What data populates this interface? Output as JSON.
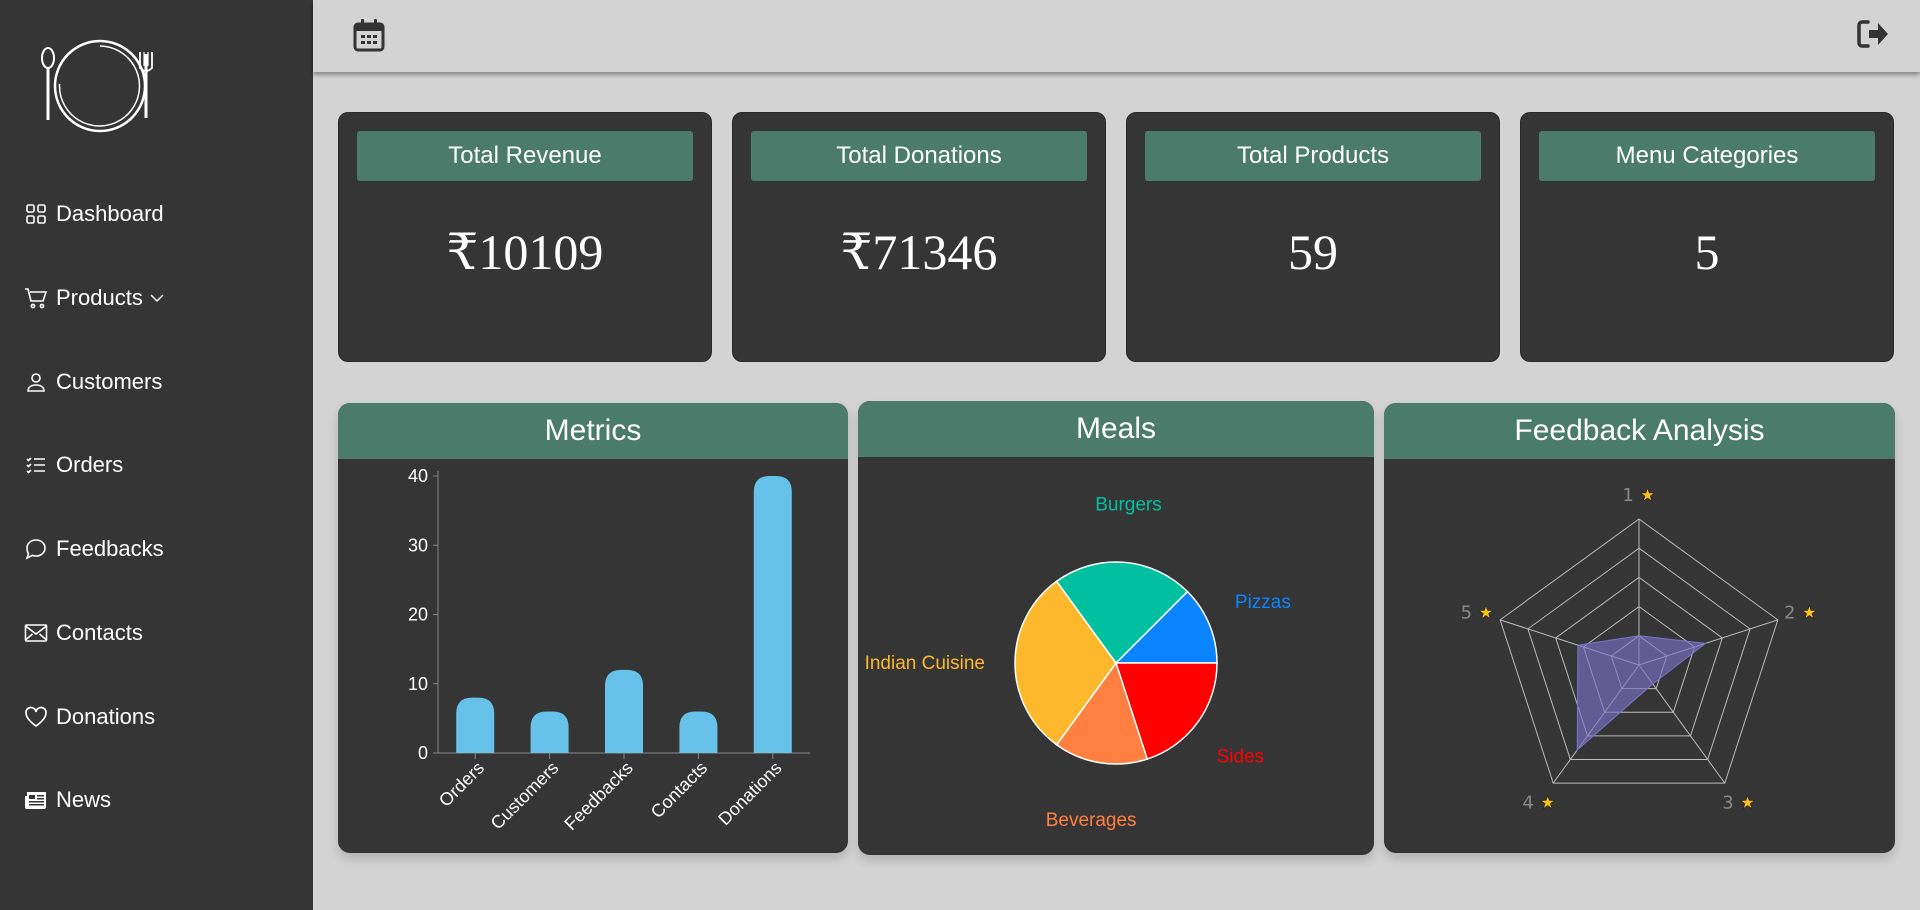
{
  "sidebar": {
    "items": [
      {
        "label": "Dashboard",
        "icon": "grid-icon"
      },
      {
        "label": "Products",
        "icon": "cart-icon",
        "has_chevron": true
      },
      {
        "label": "Customers",
        "icon": "user-icon"
      },
      {
        "label": "Orders",
        "icon": "list-icon"
      },
      {
        "label": "Feedbacks",
        "icon": "chat-bubble-icon"
      },
      {
        "label": "Contacts",
        "icon": "envelope-icon"
      },
      {
        "label": "Donations",
        "icon": "heart-icon"
      },
      {
        "label": "News",
        "icon": "newspaper-icon"
      }
    ]
  },
  "stats": [
    {
      "title": "Total Revenue",
      "value": "₹10109"
    },
    {
      "title": "Total Donations",
      "value": "₹71346"
    },
    {
      "title": "Total Products",
      "value": "59"
    },
    {
      "title": "Menu Categories",
      "value": "5"
    }
  ],
  "panels": {
    "metrics": "Metrics",
    "meals": "Meals",
    "feedback": "Feedback Analysis"
  },
  "colors": {
    "sidebar_bg": "#353535",
    "accent_header": "#4a7b6b",
    "bar_fill": "#66c2e8"
  },
  "chart_data": [
    {
      "type": "bar",
      "categories": [
        "Orders",
        "Customers",
        "Feedbacks",
        "Contacts",
        "Donations"
      ],
      "values": [
        8,
        6,
        12,
        6,
        40
      ],
      "yticks": [
        "0",
        "10",
        "20",
        "30",
        "40"
      ],
      "ylim": [
        0,
        40
      ]
    },
    {
      "type": "pie",
      "labels": [
        "Pizzas",
        "Sides",
        "Beverages",
        "Indian Cuisine",
        "Burgers"
      ],
      "values": [
        12.5,
        20,
        15,
        30,
        22.5
      ],
      "colors": [
        "#0a84ff",
        "#ff0000",
        "#ff8040",
        "#fdb92b",
        "#00c0a0"
      ]
    },
    {
      "type": "radar",
      "axes": [
        "1",
        "2",
        "3",
        "4",
        "5"
      ],
      "star_glyph": "★",
      "values": [
        1,
        2.4,
        0.8,
        3.6,
        2.2
      ],
      "rmax": 5,
      "fill": "#7b72c8"
    }
  ]
}
